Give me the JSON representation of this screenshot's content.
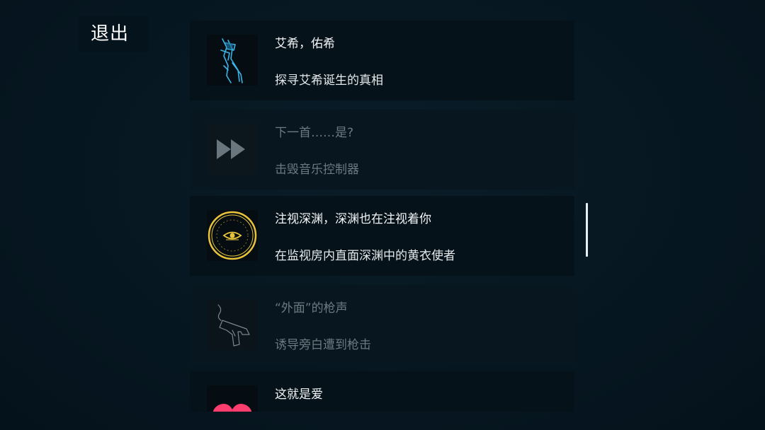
{
  "exit_label": "退出",
  "achievements": [
    {
      "title": "艾希，佑希",
      "description": "探寻艾希诞生的真相",
      "unlocked": true,
      "icon": "blue-sword-icon"
    },
    {
      "title": "下一首……是?",
      "description": "击毁音乐控制器",
      "unlocked": false,
      "icon": "fast-forward-icon"
    },
    {
      "title": "注视深渊，深渊也在注视着你",
      "description": "在监视房内直面深渊中的黄衣使者",
      "unlocked": true,
      "icon": "yellow-eye-emblem-icon"
    },
    {
      "title": "“外面”的枪声",
      "description": "诱导旁白遭到枪击",
      "unlocked": false,
      "icon": "smoking-pistol-icon"
    },
    {
      "title": "这就是爱",
      "description": "",
      "unlocked": true,
      "icon": "pink-heart-icon"
    }
  ],
  "colors": {
    "background": "#061620",
    "card": "#061219",
    "locked_text": "#6c7a82",
    "emblem_gold": "#e8c43a",
    "sword_blue": "#3ab4e6",
    "heart_pink": "#ff3d6e"
  }
}
